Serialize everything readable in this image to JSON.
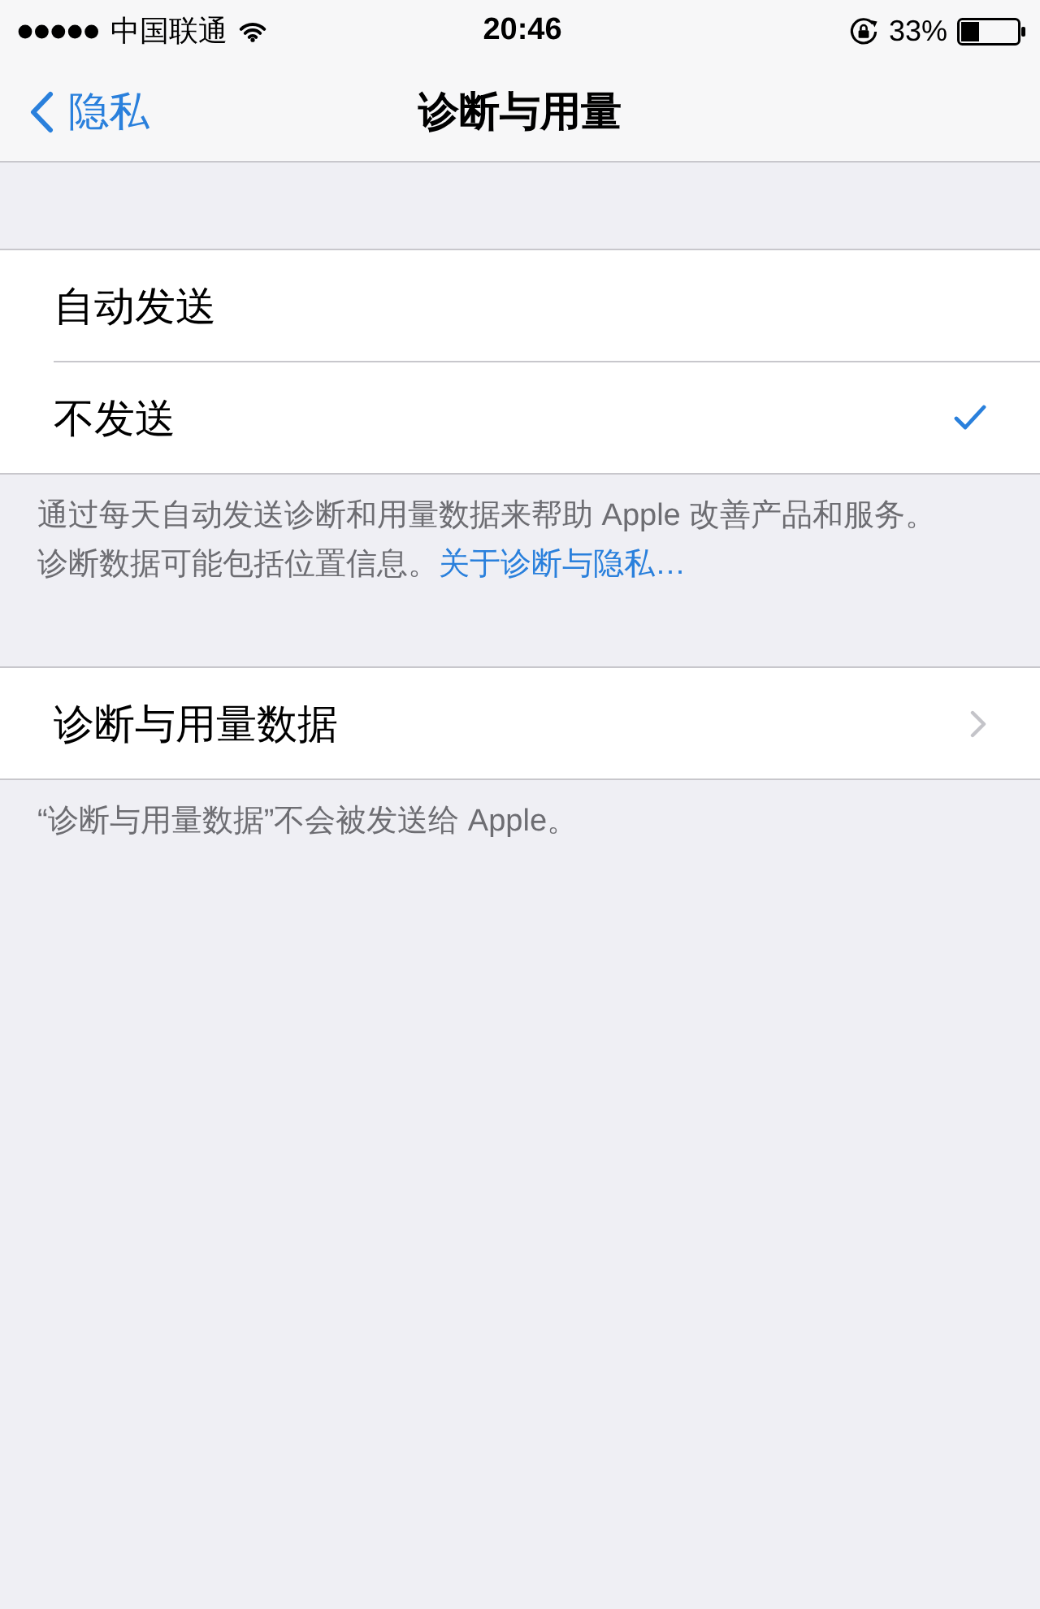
{
  "status_bar": {
    "carrier": "中国联通",
    "time": "20:46",
    "battery": "33%"
  },
  "nav_bar": {
    "back": "隐私",
    "title": "诊断与用量"
  },
  "sections": [
    {
      "rows": [
        {
          "kind": "option",
          "label": "自动发送",
          "selected": false
        },
        {
          "kind": "option",
          "label": "不发送",
          "selected": true
        }
      ],
      "footer": {
        "text": "通过每天自动发送诊断和用量数据来帮助 Apple 改善产品和服务。诊断数据可能包括位置信息。",
        "link": "关于诊断与隐私…"
      }
    },
    {
      "rows": [
        {
          "kind": "disclosure",
          "label": "诊断与用量数据"
        }
      ],
      "footer": {
        "text": "“诊断与用量数据”不会被发送给 Apple。"
      }
    }
  ]
}
